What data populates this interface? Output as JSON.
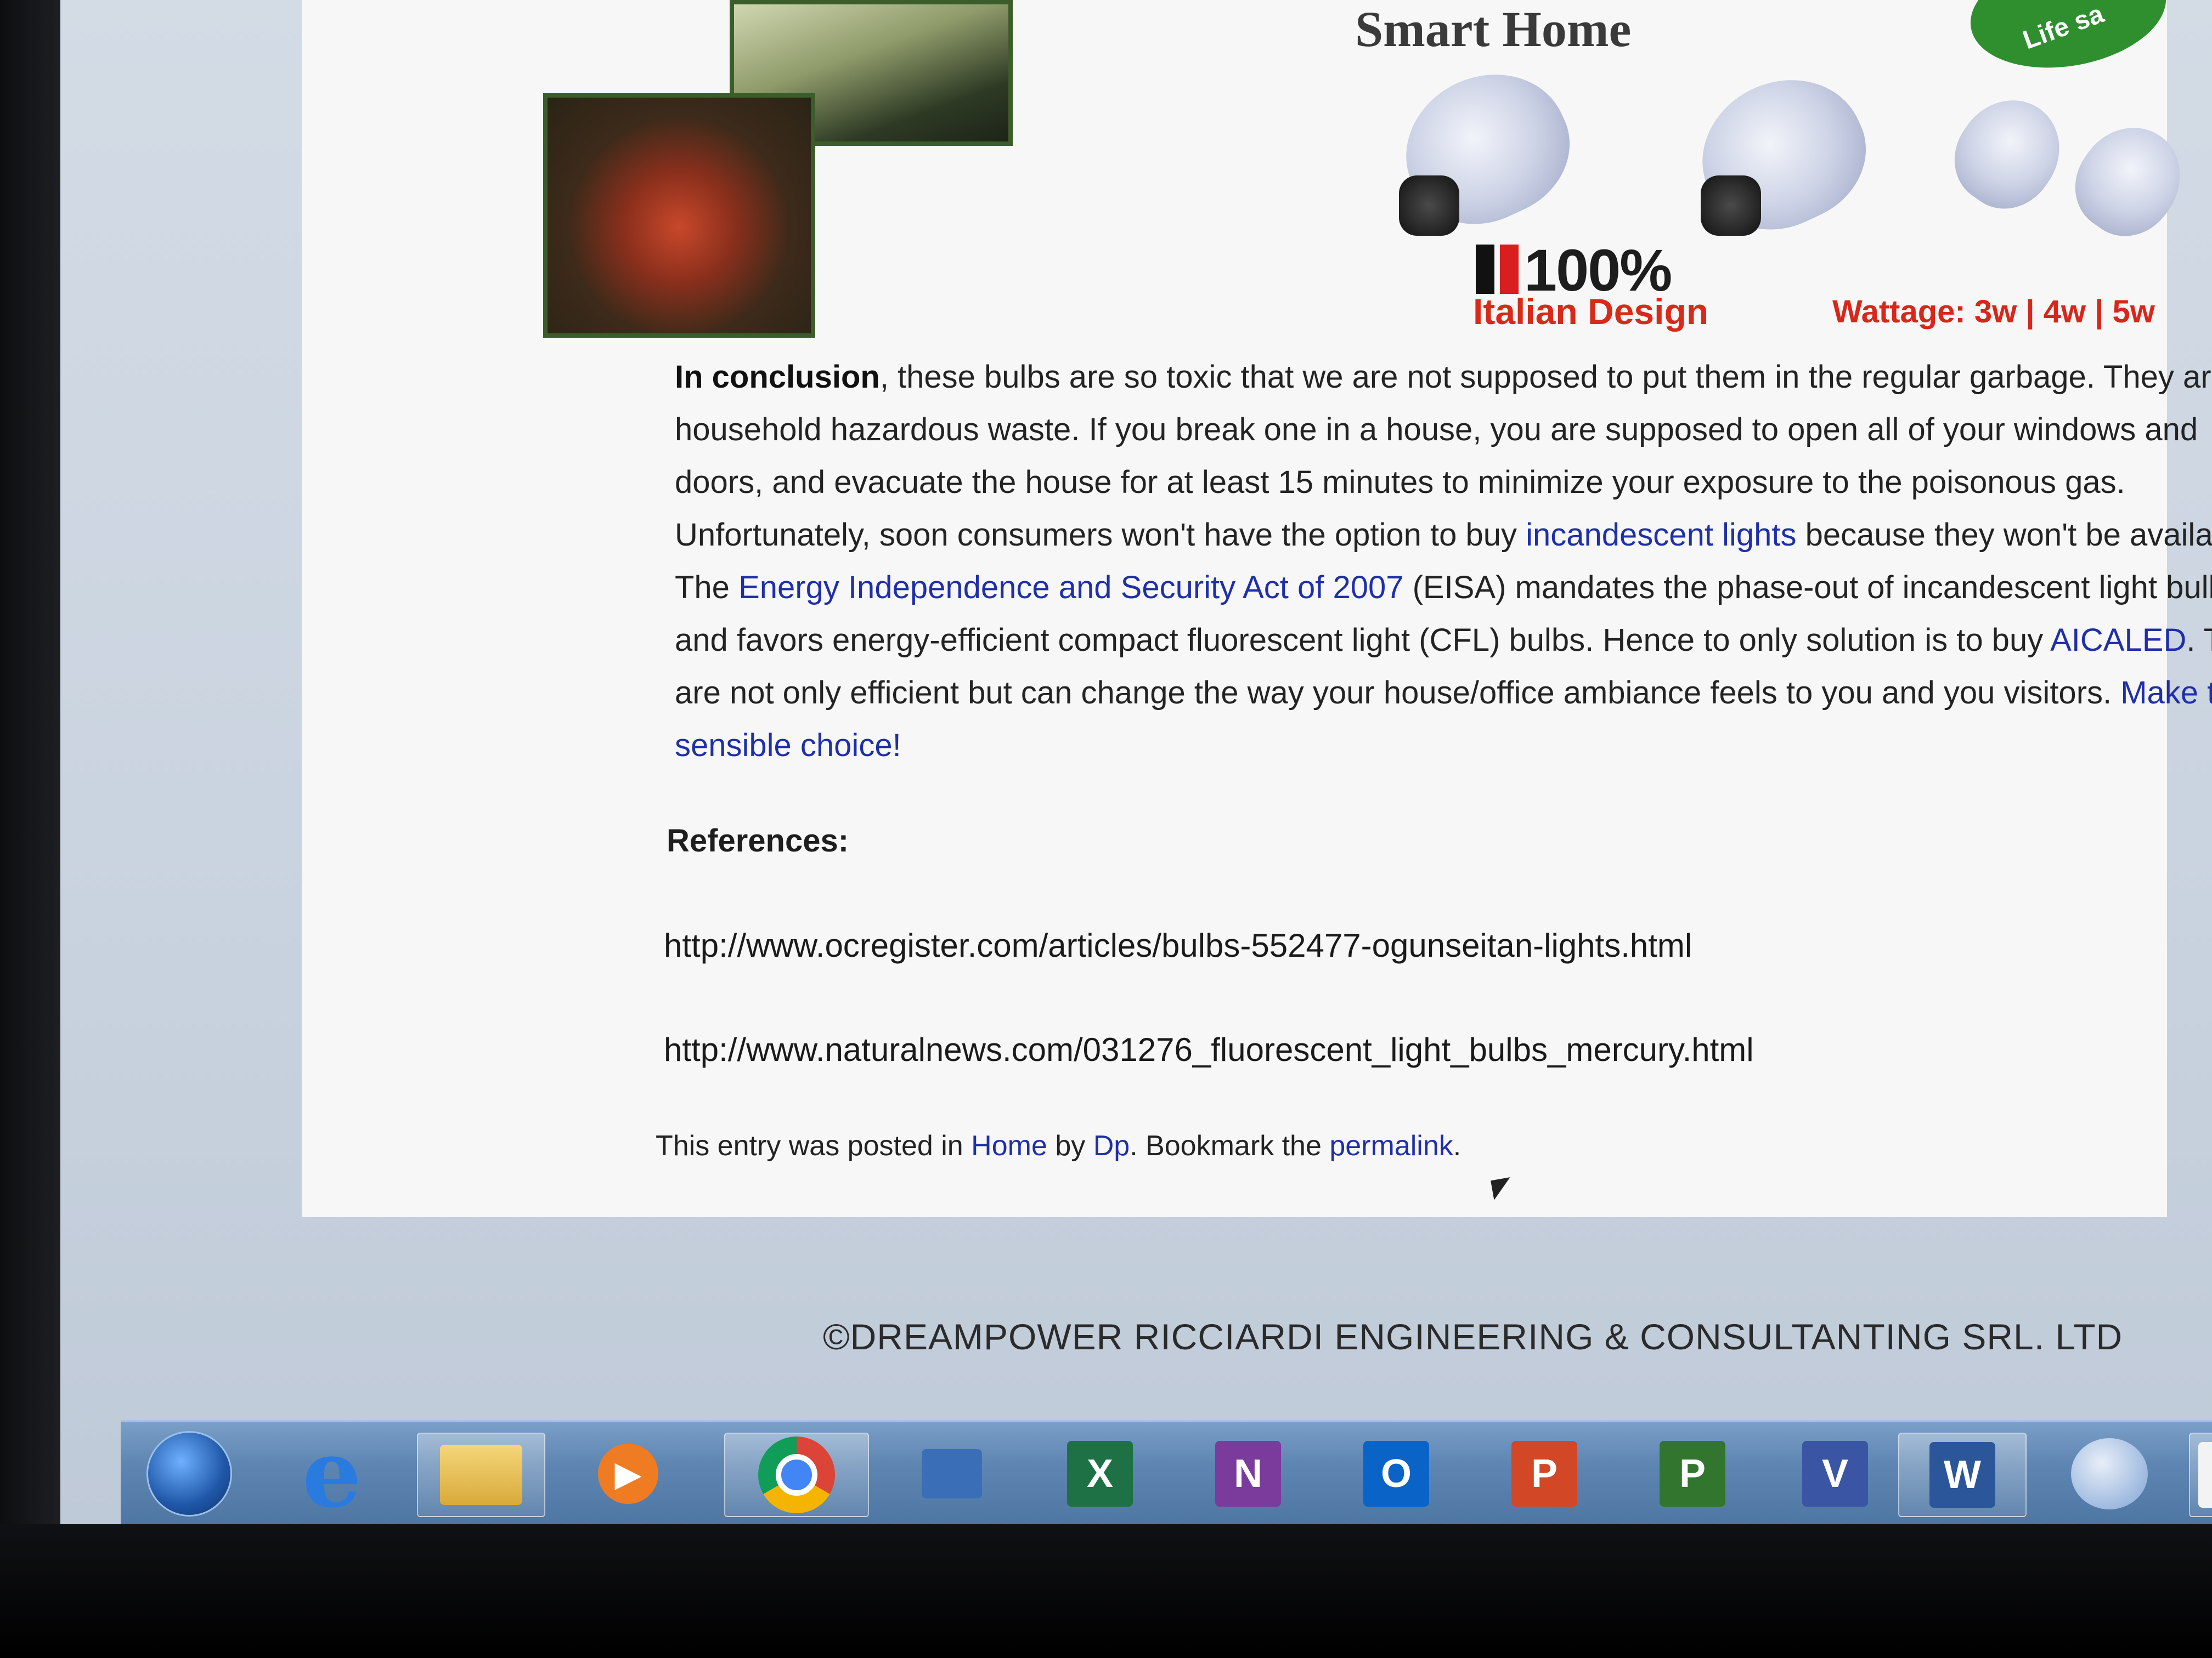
{
  "header": {
    "banner_title": "Smart Home",
    "badge_text": "Life sa",
    "percent_text": "100%",
    "italian_design": "Italian Design",
    "wattage": "Wattage: 3w | 4w | 5w"
  },
  "article": {
    "bold_lead": "In conclusion",
    "part1": ", these bulbs are so toxic that we are not supposed to put them in the regular garbage. They are household hazardous waste. If you break one in a house, you are supposed to open all of your windows and doors, and evacuate the house for at least 15 minutes to minimize your exposure to the poisonous gas. Unfortunately, soon consumers won't have the option to buy ",
    "link_incandescent": "incandescent lights",
    "part2": " because they won't be available. The ",
    "link_eisa": "Energy Independence and Security Act of 2007",
    "part3": " (EISA) mandates the phase-out of incandescent light bulbs, and favors energy-efficient compact fluorescent light (CFL) bulbs. Hence to only solution is to buy ",
    "link_aicaled": "AICALED",
    "part4": ". They are not only efficient but can change the way your house/office ambiance feels to you and you visitors. ",
    "link_choice": "Make that sensible choice!"
  },
  "references": {
    "title": "References:",
    "items": [
      "http://www.ocregister.com/articles/bulbs-552477-ogunseitan-lights.html",
      "http://www.naturalnews.com/031276_fluorescent_light_bulbs_mercury.html"
    ]
  },
  "entry_meta": {
    "prefix": "This entry was posted in ",
    "category": "Home",
    "by": " by ",
    "author": "Dp",
    "bookmark": ". Bookmark the ",
    "permalink": "permalink",
    "suffix": "."
  },
  "footer": {
    "copyright": "©DREAMPOWER RICCIARDI ENGINEERING & CONSULTANTING SRL. LTD"
  },
  "taskbar": {
    "apps": [
      {
        "name": "start-button",
        "icon": "windows-orb"
      },
      {
        "name": "internet-explorer",
        "icon": "ie-icon",
        "glyph": "e"
      },
      {
        "name": "file-explorer",
        "icon": "folder-icon"
      },
      {
        "name": "media-player",
        "icon": "media-icon",
        "glyph": "▶"
      },
      {
        "name": "chrome",
        "icon": "chrome-icon"
      },
      {
        "name": "app-blue",
        "icon": "app-icon"
      },
      {
        "name": "excel",
        "icon": "excel-icon",
        "glyph": "X",
        "color": "#1e7145"
      },
      {
        "name": "onenote",
        "icon": "onenote-icon",
        "glyph": "N",
        "color": "#7a3b9c"
      },
      {
        "name": "outlook",
        "icon": "outlook-icon",
        "glyph": "O",
        "color": "#0a64c8"
      },
      {
        "name": "powerpoint",
        "icon": "powerpoint-icon",
        "glyph": "P",
        "color": "#d24726"
      },
      {
        "name": "project",
        "icon": "project-icon",
        "glyph": "P",
        "color": "#31752f"
      },
      {
        "name": "visio",
        "icon": "visio-icon",
        "glyph": "V",
        "color": "#3955a3"
      },
      {
        "name": "word",
        "icon": "word-icon",
        "glyph": "W",
        "color": "#2b579a"
      },
      {
        "name": "thunderbird",
        "icon": "thunderbird-icon"
      },
      {
        "name": "acrobat",
        "icon": "acrobat-icon",
        "glyph": "⅄",
        "color": "#c40000"
      }
    ]
  }
}
